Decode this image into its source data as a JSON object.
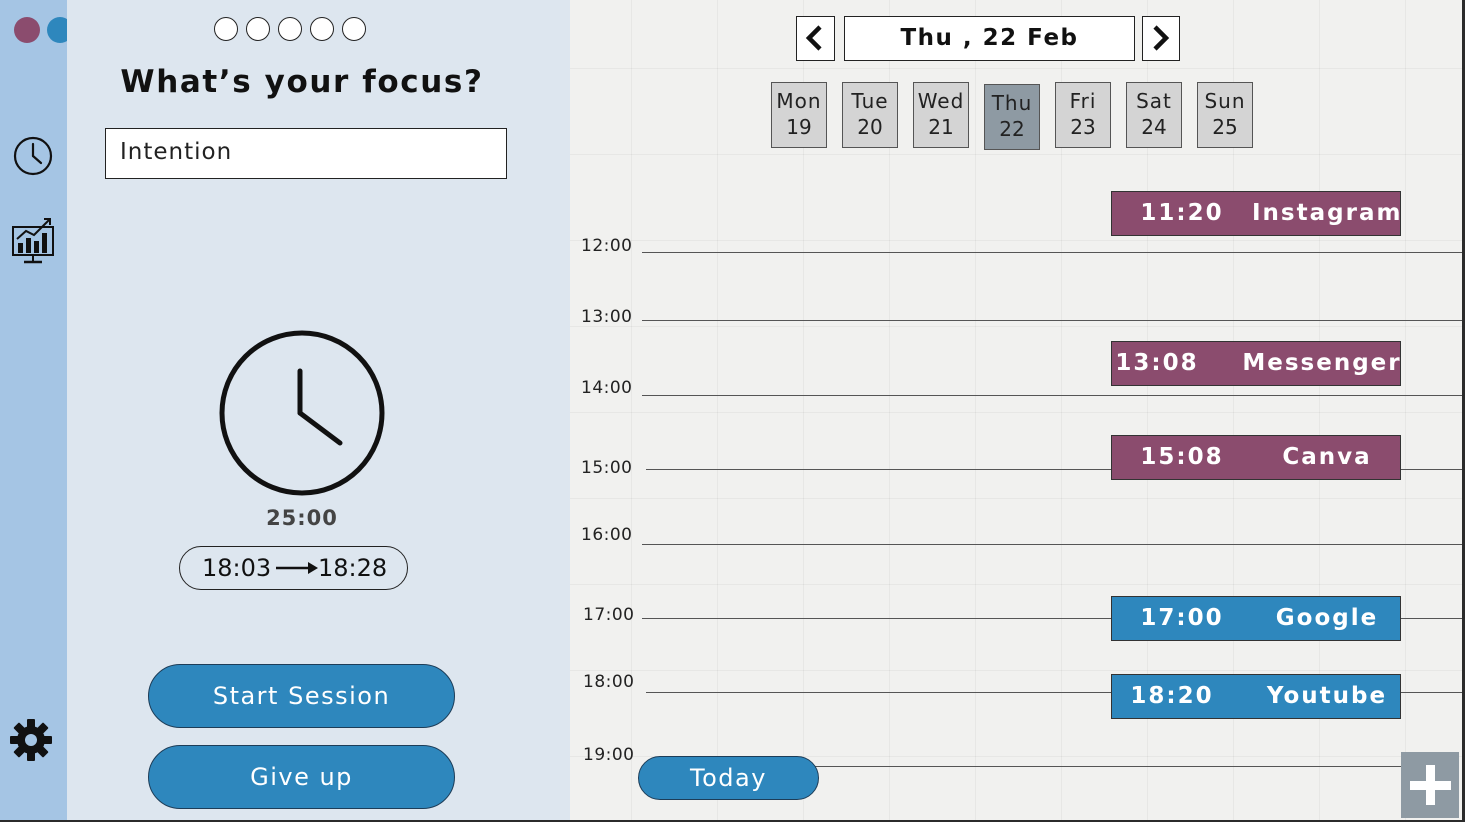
{
  "colors": {
    "rail": "#a5c5e4",
    "panel": "#dde6ef",
    "accent_blue": "#2e87bd",
    "accent_purple": "#8b4c6e",
    "grey": "#8e9aa3"
  },
  "window_controls": [
    {
      "name": "purple-dot",
      "color": "#8b4c6e"
    },
    {
      "name": "blue-dot",
      "color": "#2e87bd"
    },
    {
      "name": "grey-dot",
      "color": "#8e9aa3"
    }
  ],
  "sidebar": {
    "icons": [
      "clock-icon",
      "stats-chart-icon",
      "gear-icon"
    ]
  },
  "focus": {
    "progress_steps_total": 5,
    "progress_steps_completed": 0,
    "title": "What’s your focus?",
    "intention_value": "Intention",
    "timer": "25:00",
    "range_start": "18:03",
    "range_end": "18:28",
    "start_button": "Start Session",
    "give_up_button": "Give up"
  },
  "calendar": {
    "date_label": "Thu , 22 Feb",
    "prev_icon": "chevron-left-icon",
    "next_icon": "chevron-right-icon",
    "days": [
      {
        "name": "Mon",
        "num": "19",
        "active": false
      },
      {
        "name": "Tue",
        "num": "20",
        "active": false
      },
      {
        "name": "Wed",
        "num": "21",
        "active": false
      },
      {
        "name": "Thu",
        "num": "22",
        "active": true
      },
      {
        "name": "Fri",
        "num": "23",
        "active": false
      },
      {
        "name": "Sat",
        "num": "24",
        "active": false
      },
      {
        "name": "Sun",
        "num": "25",
        "active": false
      }
    ],
    "hours": [
      "12:00",
      "13:00",
      "14:00",
      "15:00",
      "16:00",
      "17:00",
      "18:00",
      "19:00"
    ],
    "events": [
      {
        "time": "11:20",
        "name": "Instagram",
        "color": "purple"
      },
      {
        "time": "13:08",
        "name": "Messenger",
        "color": "purple"
      },
      {
        "time": "15:08",
        "name": "Canva",
        "color": "purple"
      },
      {
        "time": "17:00",
        "name": "Google",
        "color": "blue"
      },
      {
        "time": "18:20",
        "name": "Youtube",
        "color": "blue"
      }
    ],
    "today_button": "Today",
    "add_icon": "plus-icon"
  }
}
